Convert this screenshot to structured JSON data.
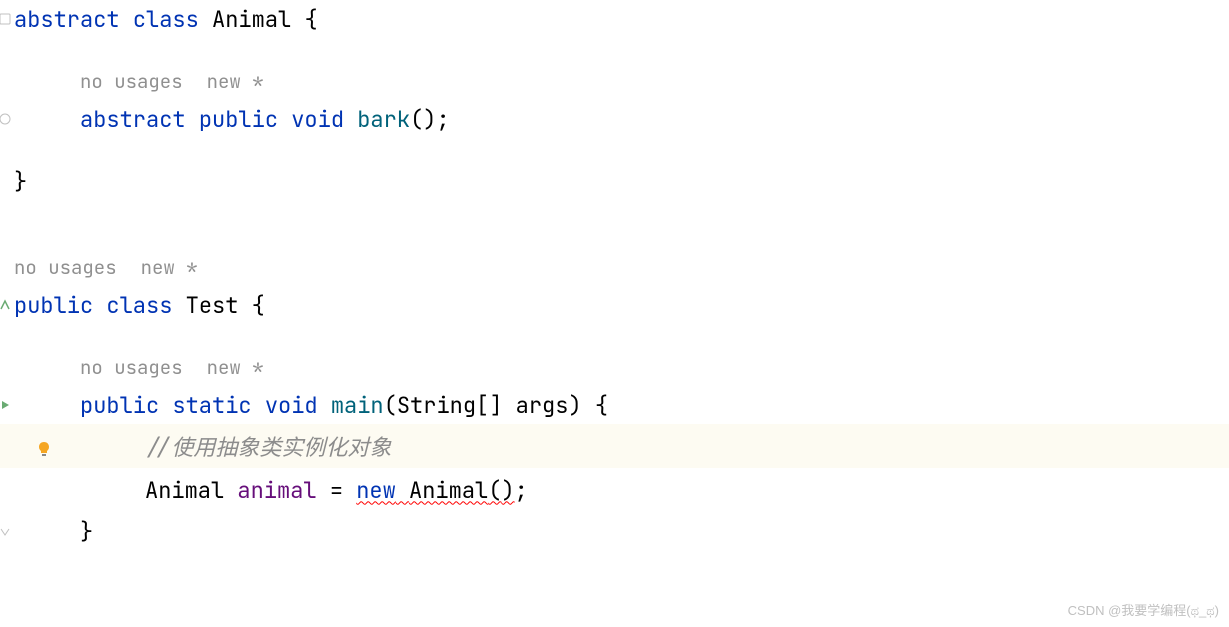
{
  "lines": {
    "l1": {
      "abstract": "abstract",
      "class": "class",
      "className": "Animal",
      "brace": "{"
    },
    "l2": {
      "noUsages": "no usages",
      "new": "new *"
    },
    "l3": {
      "abstract": "abstract",
      "public": "public",
      "void": "void",
      "method": "bark",
      "parens": "();"
    },
    "l4": {
      "brace": "}"
    },
    "l5": {
      "noUsages": "no usages",
      "new": "new *"
    },
    "l6": {
      "public": "public",
      "class": "class",
      "className": "Test",
      "brace": "{"
    },
    "l7": {
      "noUsages": "no usages",
      "new": "new *"
    },
    "l8": {
      "public": "public",
      "static": "static",
      "void": "void",
      "method": "main",
      "paramType": "String[]",
      "paramName": "args",
      "brace": "{"
    },
    "l9": {
      "comment": "//使用抽象类实例化对象"
    },
    "l10": {
      "type": "Animal",
      "varName": "animal",
      "equals": "=",
      "new": "new",
      "ctor": "Animal",
      "parens": "();"
    },
    "l11": {
      "brace": "}"
    }
  },
  "watermark": "CSDN @我要学编程(ಥ_ಥ)"
}
